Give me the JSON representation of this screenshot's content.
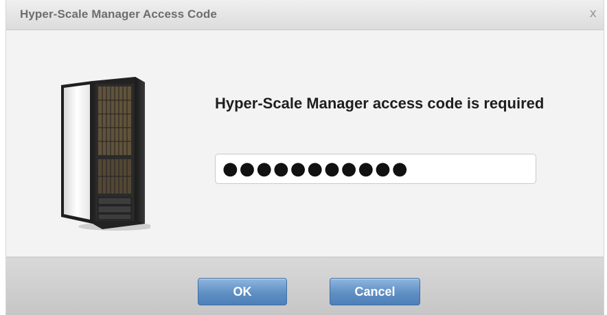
{
  "dialog": {
    "title": "Hyper-Scale Manager Access Code",
    "close_glyph": "x",
    "message": "Hyper-Scale Manager access code is required",
    "access_code_input": {
      "value": "●●●●●●●●●●●",
      "type": "password"
    },
    "buttons": {
      "ok_label": "OK",
      "cancel_label": "Cancel"
    },
    "illustration_icon": "server-rack-icon"
  },
  "colors": {
    "accent_button": "#5f8fc4",
    "dialog_background": "#f1f1f1",
    "footer_background": "#cfcfcf"
  }
}
